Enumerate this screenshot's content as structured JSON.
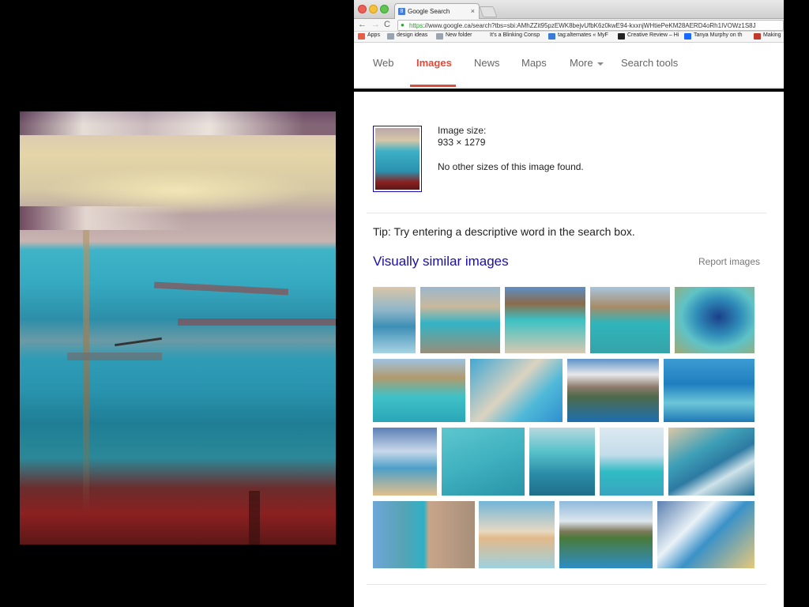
{
  "browser": {
    "tab_title": "Google Search",
    "tab_close": "×",
    "favicon": "8",
    "url_https": "https",
    "url_rest": "://www.google.ca/search?tbs=sbi:AMhZZit95pzEWK8bejvUfbK6z0kwE94-kxxnjWHtiePeKM28AERD4oRh1IVOWz1S8J",
    "nav": {
      "back": "←",
      "forward": "→",
      "reload": "C"
    },
    "bookmarks": [
      "Apps",
      "design ideas",
      "New folder",
      "It's a Blinking Consp",
      "tag:alternates « MyF",
      "Creative Review – Hi",
      "Tanya Murphy on th",
      "Making"
    ]
  },
  "google_tabs": {
    "web": "Web",
    "images": "Images",
    "news": "News",
    "maps": "Maps",
    "more": "More",
    "search_tools": "Search tools"
  },
  "result": {
    "size_label": "Image size:",
    "size_value": "933 × 1279",
    "no_other": "No other sizes of this image found.",
    "tip": "Tip: Try entering a descriptive word in the search box.",
    "similar_heading": "Visually similar images",
    "report": "Report images"
  },
  "colors": {
    "google_red": "#dd4b39",
    "link_blue": "#1a0dab"
  }
}
